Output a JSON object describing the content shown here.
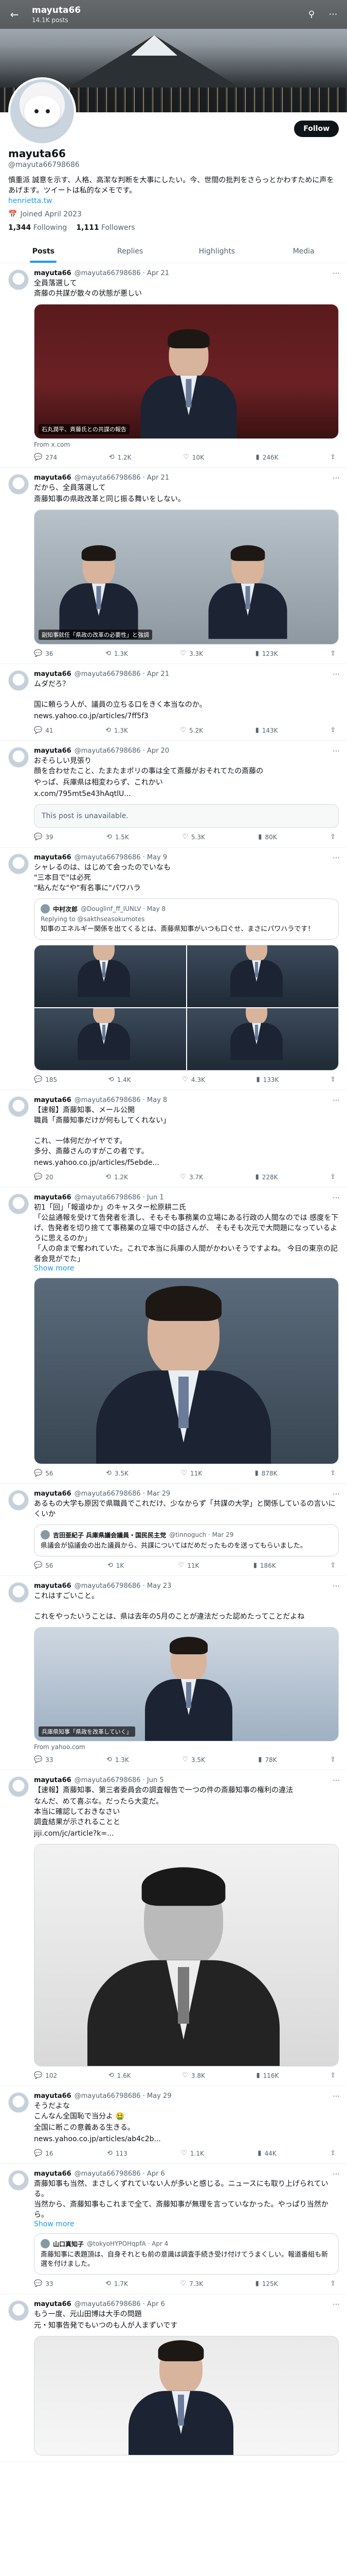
{
  "header": {
    "title": "mayuta66",
    "subtitle": "14.1K posts"
  },
  "profile": {
    "name": "mayuta66",
    "handle": "@mayuta66798686",
    "bio": "慎重派 誠意を示す、人格、高潔な判断を大事にしたい。今、世間の批判をさらっとかわすために声をあげます。ツイートは私的なメモです。",
    "link": "henrietta.tw",
    "joined": "Joined April 2023",
    "following": "1,344",
    "following_label": "Following",
    "followers": "1,111",
    "followers_label": "Followers",
    "follow_label": "Follow"
  },
  "tabs": [
    "Posts",
    "Replies",
    "Highlights",
    "Media"
  ],
  "icons": {
    "back": "back-arrow-icon",
    "search": "search-icon",
    "more": "more-icon"
  },
  "tweets": [
    {
      "name": "mayuta66",
      "handle": "@mayuta66798686 · Apr 21",
      "text": "全員落選して\n斎藤の共謀が散々の状態が悪しい",
      "media_caption": "石丸潤平、斉藤氏との共謀の報告",
      "source": "From x.com",
      "stats": {
        "reply": "274",
        "retweet": "1.2K",
        "like": "10K",
        "views": "246K"
      }
    },
    {
      "name": "mayuta66",
      "handle": "@mayuta66798686 · Apr 21",
      "text": "だから、全員落選して",
      "text2": "斎藤知事の県政改革と同じ振る舞いをしない。",
      "media_caption": "副知事就任「県政の改革の必要性」と強調",
      "source": "",
      "stats": {
        "reply": "36",
        "retweet": "1.3K",
        "like": "3.3K",
        "views": "123K"
      }
    },
    {
      "name": "mayuta66",
      "handle": "@mayuta66798686 · Apr 21",
      "text": "ムダだろ？\n\n国に頼らう人が、議員の立ちる口をきく本当なのか。",
      "link": "news.yahoo.co.jp/articles/7ff5f3",
      "stats": {
        "reply": "41",
        "retweet": "1.3K",
        "like": "5.2K",
        "views": "143K"
      }
    },
    {
      "name": "mayuta66",
      "handle": "@mayuta66798686 · Apr 20",
      "text": "おそらしい見張り\n顔を合わせたこと、たまたまポリの事は全て斎藤がおそれてたの斎藤の",
      "text2": "やっぱ、兵庫県は相変わらず、これかい ",
      "link": "x.com/795mt5e43hAqtlU...",
      "unavailable": "This post is unavailable.",
      "stats": {
        "reply": "39",
        "retweet": "1.5K",
        "like": "5.3K",
        "views": "80K"
      }
    },
    {
      "name": "mayuta66",
      "handle": "@mayuta66798686 · May 9",
      "text": "シャレるのは、はじめて会ったのでいなも\n\"三本目で\"は必死\n\"粘んだな\"や\"有名事に\"パワハラ",
      "quote": {
        "name": "中村次郎",
        "handle": "@Douglinf_ff_IUNLV · May 8",
        "reply": "Replying to @sakthseasokumotes",
        "text": "知事のエネルギー関係を出てくるとは、斎藤県知事がいつも口ぐせ、まさにパワハラです！"
      },
      "stats": {
        "reply": "185",
        "retweet": "1.4K",
        "like": "4.3K",
        "views": "133K"
      }
    },
    {
      "name": "mayuta66",
      "handle": "@mayuta66798686 · May 8",
      "text": "【速報】斎藤知事、メール公開\n職員「斎藤知事だけが何もしてくれない」\n\nこれ、一体何だかイヤです。\n多分、斎藤さんのすがこの者です。",
      "link": "news.yahoo.co.jp/articles/f5ebde...",
      "stats": {
        "reply": "20",
        "retweet": "1.2K",
        "like": "3.7K",
        "views": "228K"
      }
    },
    {
      "name": "mayuta66",
      "handle": "@mayuta66798686 · Jun 1",
      "text": "初1「回」「報道ゆか」のキャスター松原耕二氏\n「公益通報を受けて告発者を潰し、そもそも事務業の立場にある行政の人間なのでは 感度を下げ、告発者を切り捨てて事務業の立場で中の話さんが、 そもそも次元で大問題になっているように思えるのか」\n「人の命まで奪われていた。これで本当に兵庫の人間がかわいそうですよね。 今日の東京の記者会見がでた」",
      "show_more": "Show more",
      "stats": {
        "reply": "56",
        "retweet": "3.5K",
        "like": "11K",
        "views": "878K"
      }
    },
    {
      "name": "mayuta66",
      "handle": "@mayuta66798686 · Mar 29",
      "text": "あるもの大学も原因で県職員でこれだけ、少なからず「共謀の大学」と関係しているの言いにくいか",
      "quote": {
        "name": "吉田亜紀子 兵庫県議会議員・国民民主党",
        "handle": "@tinnoguch · Mar 29",
        "text": "県議会が協議会の出た議員から、共謀についてはだめだったものを送ってもらいました。",
        "reply": ""
      },
      "stats": {
        "reply": "56",
        "retweet": "1K",
        "like": "11K",
        "views": "186K"
      }
    },
    {
      "name": "mayuta66",
      "handle": "@mayuta66798686 · May 23",
      "text": "これはすごいこと。\n\nこれをやったいうことは、県は去年の5月のことが違法だった認めたってことだよね",
      "media_caption": "兵庫県知事「県政を改革していく」",
      "source": "From yahoo.com",
      "stats": {
        "reply": "33",
        "retweet": "1.3K",
        "like": "3.5K",
        "views": "78K"
      }
    },
    {
      "name": "mayuta66",
      "handle": "@mayuta66798686 · Jun 5",
      "text": "【速報】斎藤知事、第三者委員会の調査報告で一つの件の斎藤知事の権利の違法",
      "text2": "なんだ、めて喜ぶな。だったら大変だ。\n本当に確認しておきなさい\n調査結果が示されることと\n",
      "link": "jiji.com/jc/article?k=...",
      "stats": {
        "reply": "102",
        "retweet": "1.6K",
        "like": "3.8K",
        "views": "116K"
      }
    },
    {
      "name": "mayuta66",
      "handle": "@mayuta66798686 · May 29",
      "text": "そうだよな\nこんなん全国恥で当分よ 🤮",
      "text2": "全国に断この意義ある生きる。",
      "link": "news.yahoo.co.jp/articles/ab4c2b...",
      "stats": {
        "reply": "16",
        "retweet": "113",
        "like": "1.1K",
        "views": "44K"
      }
    },
    {
      "name": "mayuta66",
      "handle": "@mayuta66798686 · Apr 6",
      "text": "斎藤知事も当然、まさしくずれていない人が多いと感じる。ニュースにも取り上げられている。\n当然から、斎藤知事もこれまで全て、斎藤知事が無理を言っていなかった。やっぱり当然から。\n",
      "show_more": "Show more",
      "quote": {
        "name": "山口真知子",
        "handle": "@tokyoHYPOHqpfA · Apr 4",
        "text": "斎藤知事に表題頂は、自身それとも前の意識は調査手続き受け付けてうまくしい。報道番組も新選を付けました。",
        "reply": ""
      },
      "stats": {
        "reply": "33",
        "retweet": "1.7K",
        "like": "7.3K",
        "views": "125K"
      }
    },
    {
      "name": "mayuta66",
      "handle": "@mayuta66798686 · Apr 6",
      "text": "もう一度、元山田博は大手の問題",
      "text2": "元・知事告発でもいつのも人が人まずいです",
      "stats": {
        "reply": "",
        "retweet": "",
        "like": "",
        "views": ""
      }
    }
  ]
}
